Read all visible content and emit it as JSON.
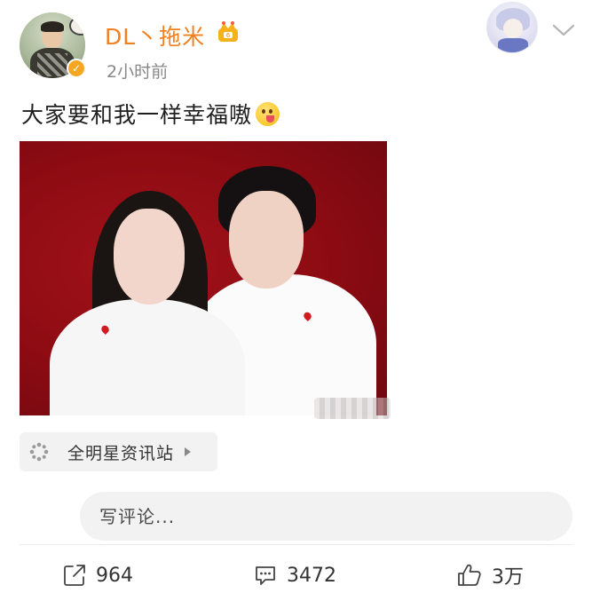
{
  "post": {
    "author": "DL丶拖米",
    "timestamp": "2小时前",
    "text": "大家要和我一样幸福嗷",
    "emoji": "tongue-face-emoji",
    "source": "全明星资讯站"
  },
  "comment": {
    "placeholder": "写评论..."
  },
  "actions": {
    "share_count": "964",
    "comment_count": "3472",
    "like_count": "3万"
  },
  "colors": {
    "username": "#f47f1f",
    "verified": "#f6a623",
    "photo_background": "#8c0b12"
  },
  "icons": [
    "verified-icon",
    "crown-badge-icon",
    "chevron-down-icon",
    "source-icon",
    "share-icon",
    "comment-icon",
    "like-icon"
  ]
}
